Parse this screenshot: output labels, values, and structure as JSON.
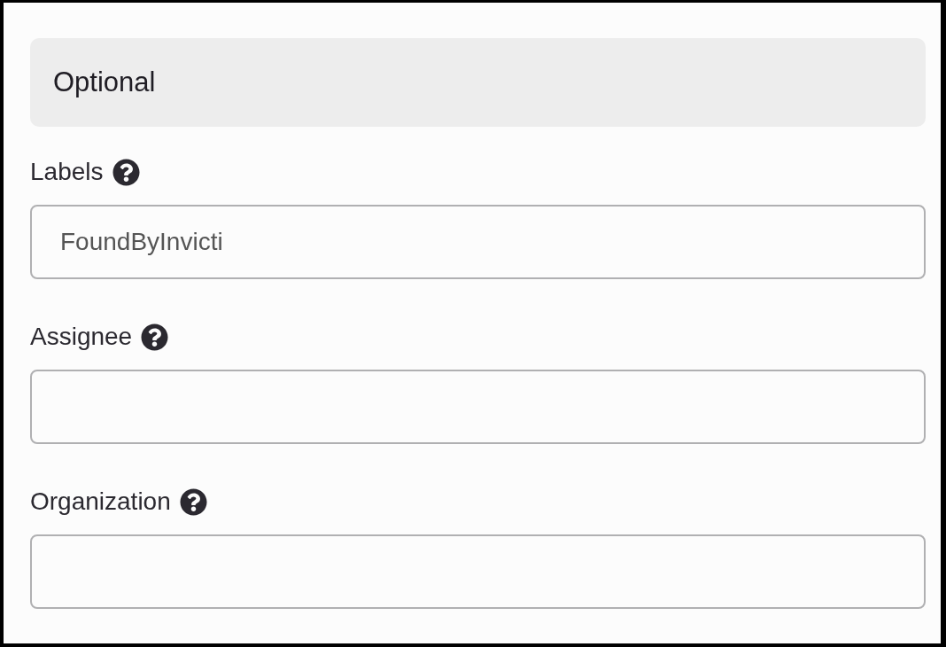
{
  "section": {
    "title": "Optional"
  },
  "fields": [
    {
      "label": "Labels",
      "value": "FoundByInvicti"
    },
    {
      "label": "Assignee"
    },
    {
      "label": "Organization"
    }
  ]
}
